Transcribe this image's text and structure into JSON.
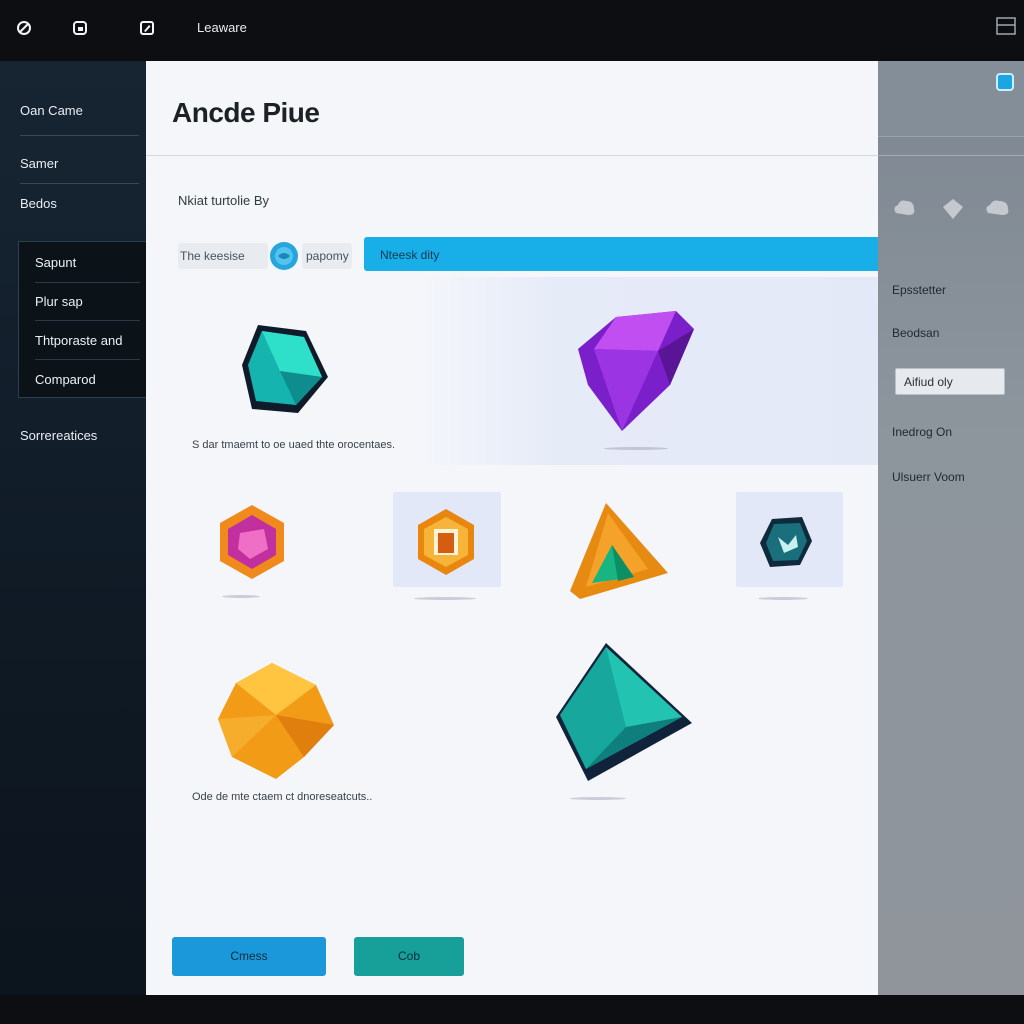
{
  "topbar": {
    "title": "Leaware",
    "icons": [
      "no-entry-icon",
      "window-icon",
      "edit-icon",
      "layout-icon"
    ]
  },
  "sidebar": {
    "items": [
      "Oan Came",
      "Samer",
      "Bedos"
    ],
    "group": [
      "Sapunt",
      "Plur sap",
      "Thtporaste and",
      "Comparod"
    ],
    "footer": "Sorrereatices"
  },
  "main": {
    "title": "Ancde Piue",
    "section_label": "Nkiat turtolie By",
    "field_left": "The keesise",
    "field_mid": "papomy",
    "blue_bar": "Nteesk dity",
    "caption_top": "S dar tmaemt to oe uaed thte orocentaes.",
    "caption_bottom": "Ode de mte ctaem ct dnoreseatcuts..",
    "buttons": {
      "primary": "Cmess",
      "secondary": "Cob"
    }
  },
  "rightpanel": {
    "items": [
      "Epsstetter",
      "Beodsan"
    ],
    "field": "Aifiud oly",
    "items2": [
      "Inedrog On",
      "Ulsuerr Voom"
    ]
  },
  "colors": {
    "accent": "#18aee8",
    "teal": "#1b9e9b",
    "purple": "#8a2ed8",
    "orange": "#f2a11e"
  }
}
